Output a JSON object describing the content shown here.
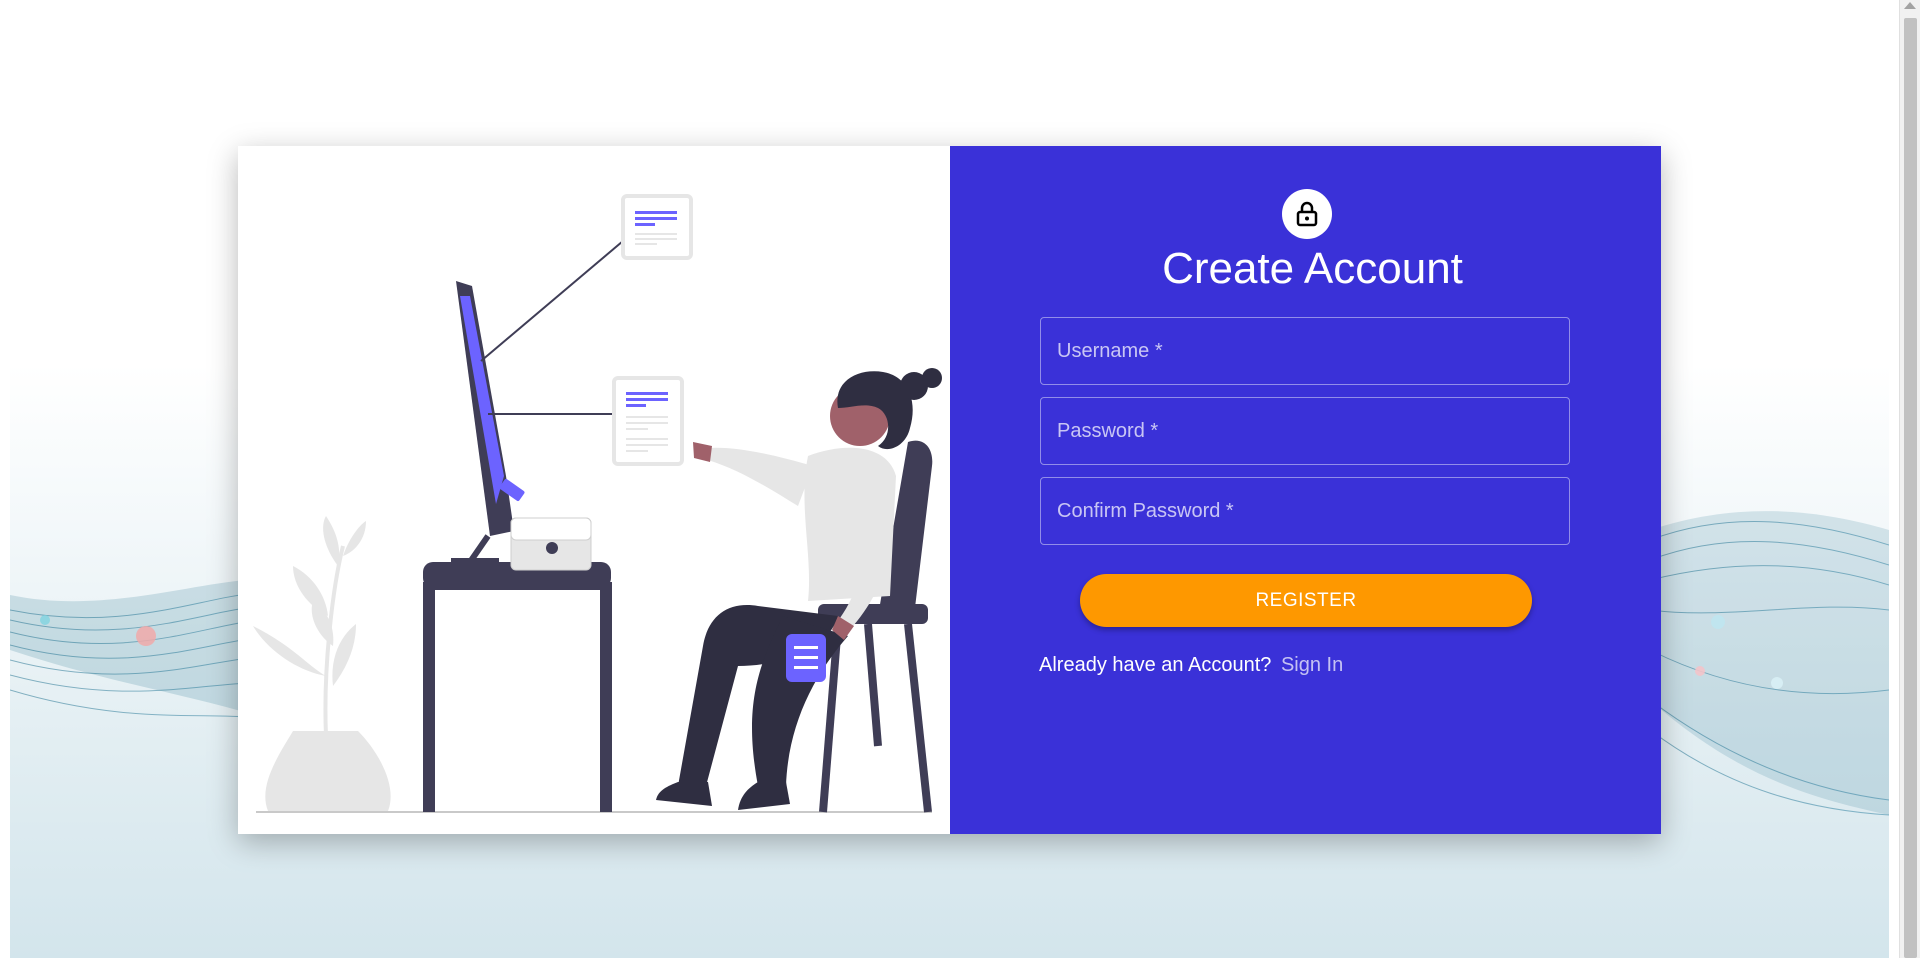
{
  "colors": {
    "form_background": "#3a31d8",
    "register_button": "#fe9800",
    "illustration_accent": "#6c63ff",
    "illustration_dark": "#3f3d56"
  },
  "form": {
    "icon": "lock-icon",
    "title": "Create Account",
    "username_placeholder": "Username *",
    "password_placeholder": "Password *",
    "confirm_password_placeholder": "Confirm Password *",
    "register_label": "REGISTER",
    "signin_prompt": "Already have an Account?",
    "signin_link": "Sign In"
  },
  "illustration": {
    "subject": "person-at-computer"
  }
}
